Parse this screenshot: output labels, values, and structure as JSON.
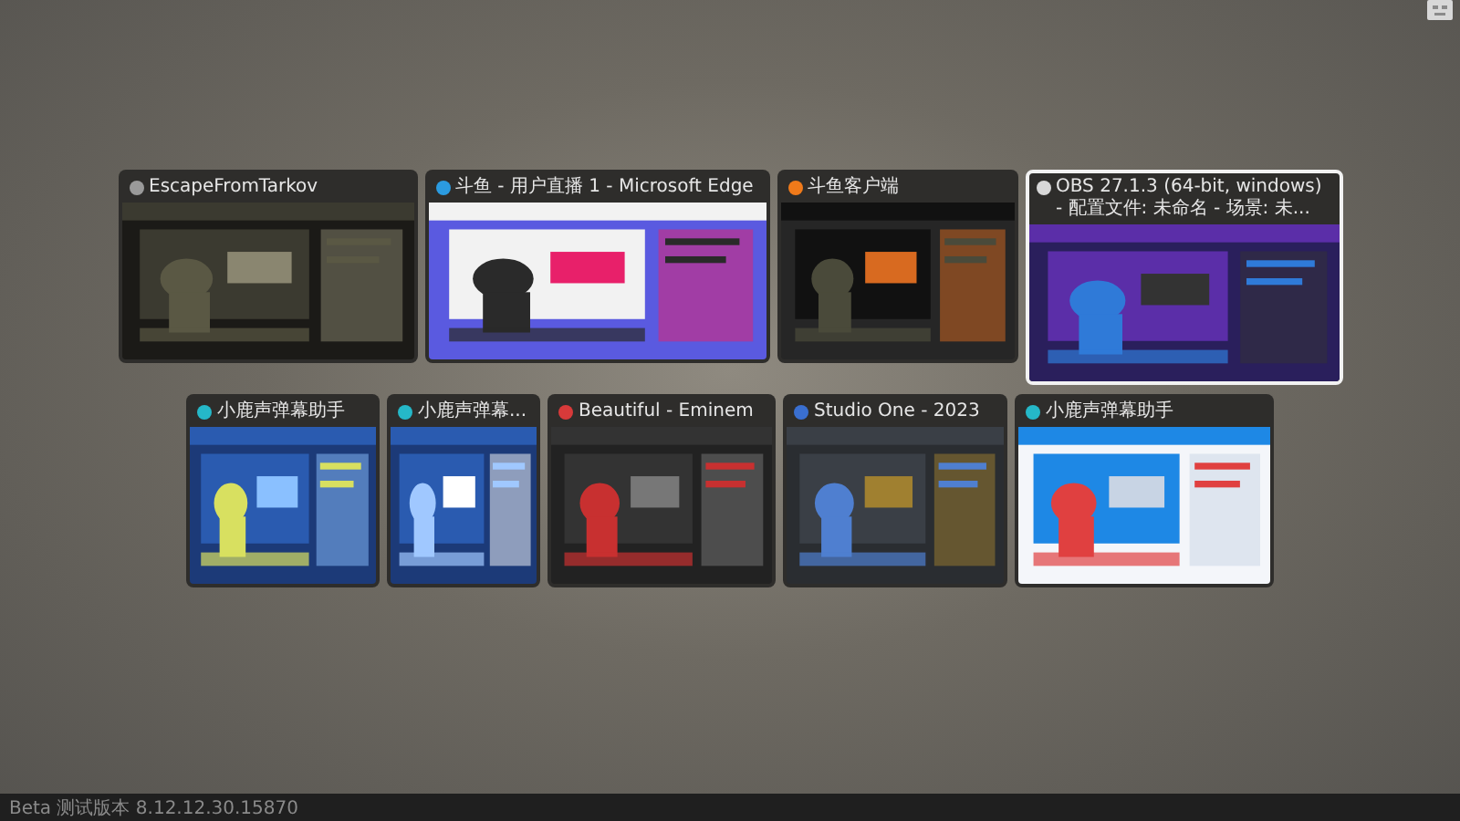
{
  "task_view": {
    "windows": [
      {
        "title": "EscapeFromTarkov",
        "selected": false
      },
      {
        "title": "斗鱼 - 用户直播 1 - Microsoft Edge",
        "selected": false
      },
      {
        "title": "斗鱼客户端",
        "selected": false
      },
      {
        "title": "OBS 27.1.3 (64-bit, windows) - 配置文件: 未命名 - 场景: 未...",
        "selected": true
      },
      {
        "title": "小鹿声弹幕助手",
        "selected": false
      },
      {
        "title": "小鹿声弹幕...",
        "selected": false
      },
      {
        "title": "Beautiful - Eminem",
        "selected": false
      },
      {
        "title": "Studio One - 2023",
        "selected": false
      },
      {
        "title": "小鹿声弹幕助手",
        "selected": false
      }
    ]
  },
  "status_bar": {
    "version": "Beta 测试版本 8.12.12.30.15870"
  }
}
